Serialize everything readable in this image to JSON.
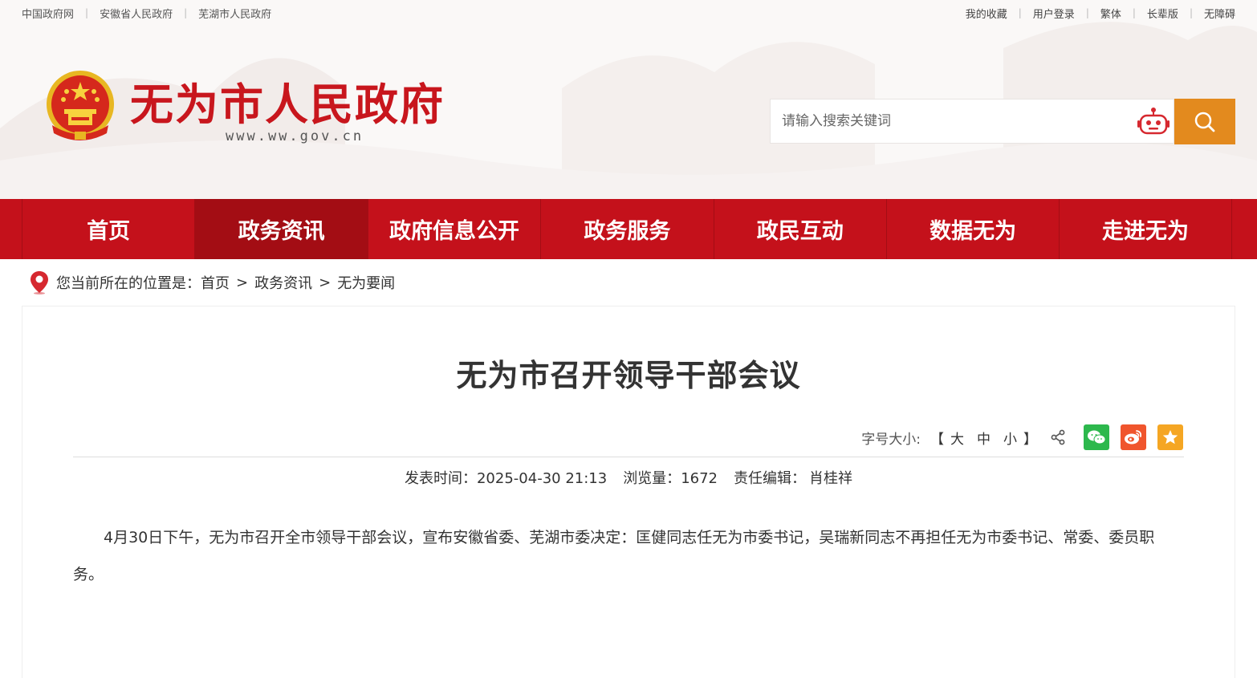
{
  "topbar": {
    "left_links": [
      "中国政府网",
      "安徽省人民政府",
      "芜湖市人民政府"
    ],
    "right_links": [
      "我的收藏",
      "用户登录",
      "繁体",
      "长辈版",
      "无障碍"
    ]
  },
  "site": {
    "title": "无为市人民政府",
    "url": "www.ww.gov.cn"
  },
  "search": {
    "placeholder": "请输入搜索关键词",
    "value": ""
  },
  "nav": {
    "items": [
      "首页",
      "政务资讯",
      "政府信息公开",
      "政务服务",
      "政民互动",
      "数据无为",
      "走进无为"
    ],
    "active_index": 1
  },
  "breadcrumb": {
    "prefix": "您当前所在的位置是：",
    "items": [
      "首页",
      "政务资讯",
      "无为要闻"
    ]
  },
  "article": {
    "title": "无为市召开领导干部会议",
    "font_size_label": "字号大小:",
    "font_sizes": [
      "大",
      "中",
      "小"
    ],
    "publish_label": "发表时间：",
    "publish_time": "2025-04-30 21:13",
    "views_label": "浏览量：",
    "views": "1672",
    "editor_label": "责任编辑：",
    "editor": "肖桂祥",
    "body": "4月30日下午，无为市召开全市领导干部会议，宣布安徽省委、芜湖市委决定：匡健同志任无为市委书记，吴瑞新同志不再担任无为市委书记、常委、委员职务。"
  },
  "colors": {
    "brand_red": "#c4111b",
    "nav_active": "#a30d14",
    "search_button": "#e38a1e",
    "wechat": "#2db84d",
    "weibo": "#f0552d",
    "favorite": "#f5a623"
  }
}
